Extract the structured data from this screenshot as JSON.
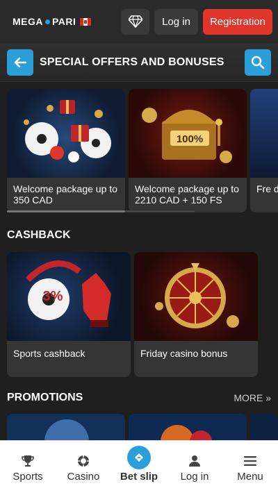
{
  "header": {
    "logo_left": "MEGA",
    "logo_right": "PARI",
    "login_label": "Log in",
    "register_label": "Registration",
    "accent": "#2a9fd8",
    "register_color": "#e0352b"
  },
  "subheader": {
    "title": "SPECIAL OFFERS AND BONUSES"
  },
  "offers": [
    {
      "label": "Welcome package up to 350 CAD",
      "icon": "sports-balls-gifts"
    },
    {
      "label": "Welcome package up to 2210 CAD + 150 FS",
      "icon": "treasure-chest"
    },
    {
      "label": "Fre dep",
      "icon": "partial-card"
    }
  ],
  "cashback": {
    "title": "CASHBACK",
    "items": [
      {
        "label": "Sports cashback",
        "badge": "3%"
      },
      {
        "label": "Friday casino bonus",
        "icon": "wheel-of-fortune"
      }
    ]
  },
  "promotions": {
    "title": "PROMOTIONS",
    "more_label": "MORE »"
  },
  "bottom_nav": [
    {
      "label": "Sports",
      "icon": "trophy-icon"
    },
    {
      "label": "Casino",
      "icon": "chip-icon"
    },
    {
      "label": "Bet slip",
      "icon": "ticket-icon"
    },
    {
      "label": "Log in",
      "icon": "user-icon"
    },
    {
      "label": "Menu",
      "icon": "menu-icon"
    }
  ]
}
